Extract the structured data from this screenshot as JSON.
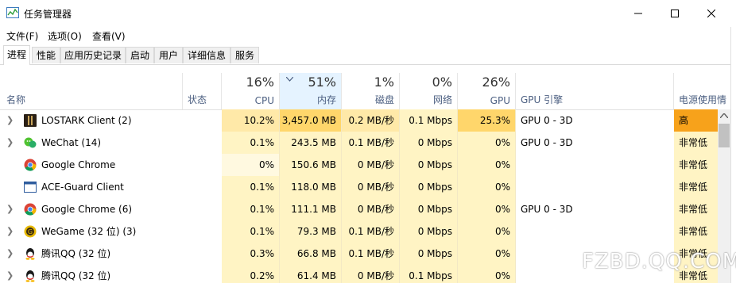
{
  "window": {
    "title": "任务管理器",
    "controls": [
      "minimize-icon",
      "maximize-icon",
      "close-icon"
    ]
  },
  "menu": [
    "文件(F)",
    "选项(O)",
    "查看(V)"
  ],
  "tabs": [
    "进程",
    "性能",
    "应用历史记录",
    "启动",
    "用户",
    "详细信息",
    "服务"
  ],
  "columns": {
    "name": "名称",
    "status": "状态",
    "cpu": {
      "pct": "16%",
      "label": "CPU"
    },
    "memory": {
      "pct": "51%",
      "label": "内存"
    },
    "disk": {
      "pct": "1%",
      "label": "磁盘"
    },
    "network": {
      "pct": "0%",
      "label": "网络"
    },
    "gpu": {
      "pct": "26%",
      "label": "GPU"
    },
    "gpu_engine": "GPU 引擎",
    "power": "电源使用情"
  },
  "processes": [
    {
      "name": "LOSTARK Client (2)",
      "icon": "lostark-icon",
      "expand": true,
      "cpu": "10.2%",
      "mem": "3,457.0 MB",
      "disk": "0.2 MB/秒",
      "net": "0.1 Mbps",
      "gpu": "25.3%",
      "engine": "GPU 0 - 3D",
      "power": "高"
    },
    {
      "name": "WeChat (14)",
      "icon": "wechat-icon",
      "expand": true,
      "cpu": "0.1%",
      "mem": "243.5 MB",
      "disk": "0.1 MB/秒",
      "net": "0 Mbps",
      "gpu": "0%",
      "engine": "GPU 0 - 3D",
      "power": "非常低"
    },
    {
      "name": "Google Chrome",
      "icon": "chrome-icon",
      "expand": false,
      "cpu": "0%",
      "mem": "150.6 MB",
      "disk": "0 MB/秒",
      "net": "0 Mbps",
      "gpu": "0%",
      "engine": "",
      "power": "非常低"
    },
    {
      "name": "ACE-Guard Client",
      "icon": "ace-guard-icon",
      "expand": false,
      "cpu": "0.1%",
      "mem": "118.0 MB",
      "disk": "0 MB/秒",
      "net": "0 Mbps",
      "gpu": "0%",
      "engine": "",
      "power": "非常低"
    },
    {
      "name": "Google Chrome (6)",
      "icon": "chrome-icon",
      "expand": true,
      "cpu": "0.1%",
      "mem": "111.1 MB",
      "disk": "0 MB/秒",
      "net": "0 Mbps",
      "gpu": "0%",
      "engine": "GPU 0 - 3D",
      "power": "非常低"
    },
    {
      "name": "WeGame (32 位) (3)",
      "icon": "wegame-icon",
      "expand": true,
      "cpu": "0.1%",
      "mem": "79.3 MB",
      "disk": "0.1 MB/秒",
      "net": "0 Mbps",
      "gpu": "0%",
      "engine": "",
      "power": "非常低"
    },
    {
      "name": "腾讯QQ (32 位)",
      "icon": "qq-icon",
      "expand": true,
      "cpu": "0.3%",
      "mem": "66.8 MB",
      "disk": "0.1 MB/秒",
      "net": "0 Mbps",
      "gpu": "0%",
      "engine": "",
      "power": "非常低"
    },
    {
      "name": "腾讯QQ (32 位)",
      "icon": "qq-icon",
      "expand": true,
      "cpu": "0.2%",
      "mem": "61.4 MB",
      "disk": "0 MB/秒",
      "net": "0.1 Mbps",
      "gpu": "0%",
      "engine": "",
      "power": "非常低"
    }
  ],
  "watermark": "FZBD.QQ.COM",
  "colors": {
    "heat_light": "#fff4c4",
    "heat_mid": "#ffe9a8",
    "heat_high": "#ffd66b",
    "power_high": "#f7a21b",
    "accent": "#cce8ff"
  }
}
